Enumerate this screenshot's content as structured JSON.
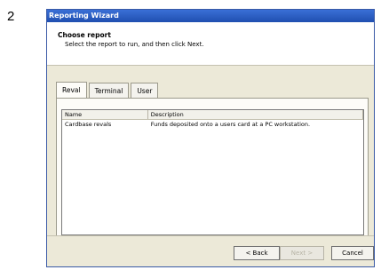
{
  "step": {
    "number": "2"
  },
  "window": {
    "title": "Reporting Wizard"
  },
  "header": {
    "title": "Choose report",
    "subtitle": "Select the report to run, and then click Next."
  },
  "tabs": [
    {
      "label": "Reval",
      "active": true
    },
    {
      "label": "Terminal",
      "active": false
    },
    {
      "label": "User",
      "active": false
    }
  ],
  "listview": {
    "columns": [
      "Name",
      "Description"
    ],
    "rows": [
      {
        "name": "Cardbase revals",
        "description": "Funds deposited onto a users card at a PC workstation."
      }
    ]
  },
  "buttons": {
    "back": "< Back",
    "next": "Next >",
    "cancel": "Cancel"
  }
}
